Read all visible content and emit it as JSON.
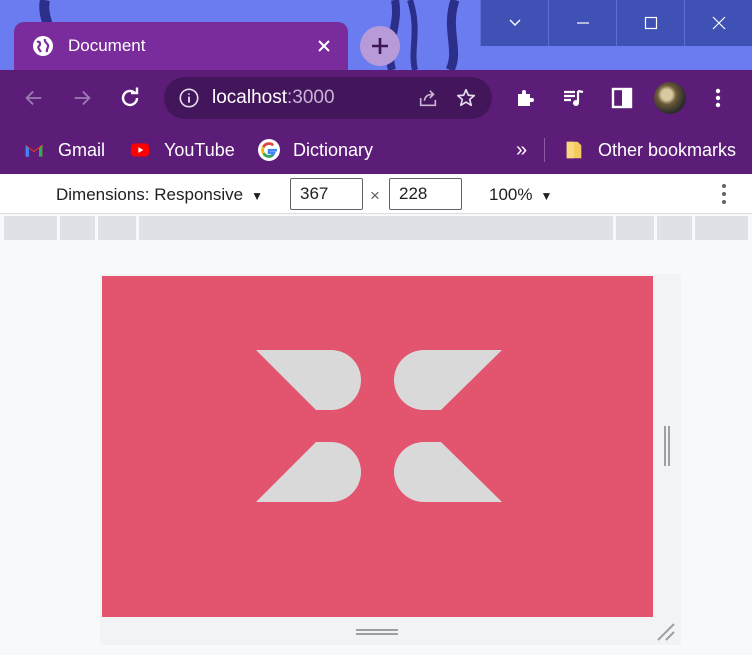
{
  "tab": {
    "title": "Document",
    "favicon": "globe-icon"
  },
  "address": {
    "host": "localhost",
    "port": ":3000"
  },
  "bookmarks": {
    "items": [
      {
        "label": "Gmail",
        "icon": "gmail-icon"
      },
      {
        "label": "YouTube",
        "icon": "youtube-icon"
      },
      {
        "label": "Dictionary",
        "icon": "google-icon"
      }
    ],
    "overflow": "»",
    "other": "Other bookmarks"
  },
  "device_toolbar": {
    "dimensions_label": "Dimensions: Responsive",
    "width": "367",
    "times": "×",
    "height": "228",
    "zoom": "100%"
  },
  "colors": {
    "tab_bg": "#7a2c9c",
    "toolbar_bg": "#5c1d78",
    "page_bg": "#e3546e",
    "logo_fill": "#d9d9d9"
  }
}
